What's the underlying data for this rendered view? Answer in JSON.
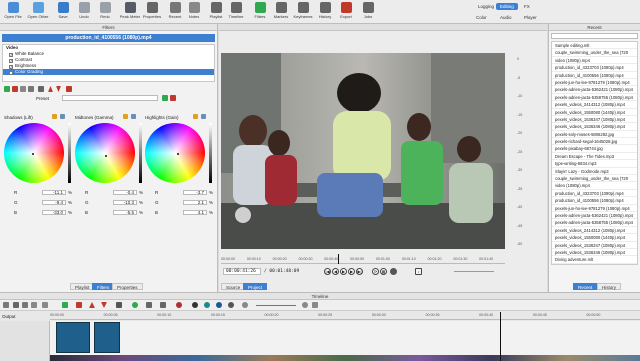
{
  "toolbar": {
    "buttons": [
      {
        "label": "Open File",
        "icon": "open-file-icon",
        "color": "#4a8ed8"
      },
      {
        "label": "Open Other",
        "icon": "open-other-icon",
        "color": "#5aa0e0"
      },
      {
        "label": "Save",
        "icon": "save-icon",
        "color": "#3a7bc8"
      },
      {
        "label": "Undo",
        "icon": "undo-icon",
        "color": "#9aa0a8"
      },
      {
        "label": "Redo",
        "icon": "redo-icon",
        "color": "#9aa0a8"
      },
      {
        "label": "Peak Meter",
        "icon": "peak-meter-icon",
        "color": "#555c66"
      },
      {
        "label": "Properties",
        "icon": "properties-icon",
        "color": "#666"
      },
      {
        "label": "Recent",
        "icon": "recent-icon",
        "color": "#777"
      },
      {
        "label": "Notes",
        "icon": "notes-icon",
        "color": "#888"
      },
      {
        "label": "Playlist",
        "icon": "playlist-icon",
        "color": "#666"
      },
      {
        "label": "Timeline",
        "icon": "timeline-icon",
        "color": "#666"
      },
      {
        "label": "Filters",
        "icon": "filters-icon",
        "color": "#2fa84f"
      },
      {
        "label": "Markers",
        "icon": "markers-icon",
        "color": "#666"
      },
      {
        "label": "Keyframes",
        "icon": "keyframes-icon",
        "color": "#666"
      },
      {
        "label": "History",
        "icon": "history-icon",
        "color": "#666"
      },
      {
        "label": "Export",
        "icon": "export-icon",
        "color": "#c0392b"
      },
      {
        "label": "Jobs",
        "icon": "jobs-icon",
        "color": "#666"
      }
    ],
    "layouts": [
      "Logging",
      "Editing",
      "FX",
      "Color",
      "Audio",
      "Player"
    ],
    "active_layout": "Editing"
  },
  "filters": {
    "header": "Filters",
    "clip_title": "production_id_4100556 (1080p).mp4",
    "section": "Video",
    "items": [
      {
        "label": "White Balance",
        "checked": true,
        "selected": false
      },
      {
        "label": "Contrast",
        "checked": true,
        "selected": false
      },
      {
        "label": "Brightness",
        "checked": true,
        "selected": false
      },
      {
        "label": "Color Grading",
        "checked": true,
        "selected": true
      }
    ],
    "preset_label": "Preset",
    "wheels": [
      {
        "title": "Shadows (Lift)",
        "r": "-11.1",
        "g": "-9.4",
        "b": "-33.0",
        "r_label": "R",
        "g_label": "G",
        "b_label": "B",
        "unit": "%"
      },
      {
        "title": "Midtones (Gamma)",
        "r": "-0.4",
        "g": "-10.3",
        "b": "-5.5",
        "r_label": "R",
        "g_label": "G",
        "b_label": "B",
        "unit": "%"
      },
      {
        "title": "Highlights (Gain)",
        "r": "-3.7",
        "g": "2.1",
        "b": "4.1",
        "r_label": "R",
        "g_label": "G",
        "b_label": "B",
        "unit": "%"
      }
    ],
    "tabs": [
      "Playlist",
      "Filters",
      "Properties"
    ],
    "active_tab": "Filters"
  },
  "player": {
    "ruler": [
      "00:00:00",
      "00:00:10",
      "00:00:20",
      "00:00:30",
      "00:00:40",
      "00:00:50",
      "00:01:00",
      "00:01:10",
      "00:01:20",
      "00:01:30",
      "00:01:40"
    ],
    "current_time": "00:00:41:26",
    "total_time": "/ 00:01:48:09",
    "tabs": [
      "Source",
      "Project"
    ],
    "active_tab": "Project",
    "meter_labels": [
      "0",
      "-5",
      "-10",
      "-15",
      "-20",
      "-25",
      "-30",
      "-35",
      "-40",
      "-45",
      "-50"
    ]
  },
  "recent": {
    "header": "Recent",
    "search_placeholder": "",
    "items": [
      "Sample editing.mlt",
      "couple_swimming_under_the_sea (720",
      "video (1080p).mp4",
      "production_id_4323703 (1080p).mp4",
      "production_id_4100556 (1080p).mp4",
      "pexels-jun-ho-lee-9781279 (1080p).mp4",
      "pexels-adrien-jacta-5362421 (1080p).mp4",
      "pexels-adrien-jacta-5358755 (1080p).mp4",
      "pexels_videos_2414312 (1080p).mp4",
      "pexels_videos_1550080 (1440p).mp4",
      "pexels_videos_1536347 (1080p).mp4",
      "pexels_videos_1536346 (1080p).mp4",
      "pexels-soly-moses-5806282.jpg",
      "pexels-richard-segal-1645028.jpg",
      "pexels-pixabay-68744.jpg",
      "Dream Escape - The Tides.mp3",
      "type-writing-6834.mp3",
      "Slayin' Lazy - Godmode.mp3",
      "couple_swimming_under_the_sea (720",
      "video (1080p).mp4",
      "production_id_4323703 (1080p).mp4",
      "production_id_4100556 (1080p).mp4",
      "pexels-jun-ho-lee-9781279 (1080p).mp4",
      "pexels-adrien-jacta-5362421 (1080p).mp4",
      "pexels-adrien-jacta-5358755 (1080p).mp4",
      "pexels_videos_2414312 (1080p).mp4",
      "pexels_videos_1550080 (1440p).mp4",
      "pexels_videos_1536347 (1080p).mp4",
      "pexels_videos_1536346 (1080p).mp4",
      "Diving adventure.mlt"
    ],
    "tabs": [
      "Recent",
      "History"
    ],
    "active_tab": "Recent"
  },
  "timeline": {
    "header": "Timeline",
    "track_output": "Output",
    "track_text": "Text",
    "ruler": [
      "00:00:00",
      "00:00:05",
      "00:00:10",
      "00:00:15",
      "00:00:20",
      "00:00:25",
      "00:00:30",
      "00:00:35",
      "00:00:40",
      "00:00:45",
      "00:00:50"
    ]
  }
}
